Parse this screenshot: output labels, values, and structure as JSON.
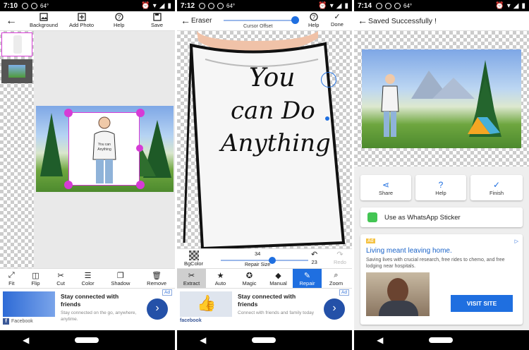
{
  "status": [
    {
      "time": "7:10",
      "temp": "64°"
    },
    {
      "time": "7:12",
      "temp": "64°"
    },
    {
      "time": "7:14",
      "temp": "64°"
    }
  ],
  "screen1": {
    "toolbar": {
      "background": "Background",
      "add_photo": "Add Photo",
      "help": "Help",
      "save": "Save"
    },
    "bottom_tools": [
      "Fit",
      "Flip",
      "Cut",
      "Color",
      "Shadow",
      "Remove"
    ],
    "ad": {
      "tag": "Ad",
      "title": "Stay connected with friends",
      "body": "Stay connected on the go, anywhere, anytime.",
      "advertiser": "Facebook"
    }
  },
  "screen2": {
    "title": "Eraser",
    "slider_label": "Cursor Offset",
    "help": "Help",
    "done": "Done",
    "bgcolor": "BgColor",
    "repair_size_value": "34",
    "repair_size_label": "Repair Size",
    "undo_count": "23",
    "redo": "Redo",
    "tools": [
      "Extract",
      "Auto",
      "Magic",
      "Manual",
      "Repair",
      "Zoom"
    ],
    "active_tool": "Repair",
    "shirt_text": [
      "You",
      "can Do",
      "Anything"
    ],
    "ad": {
      "tag": "Ad",
      "title": "Stay connected with friends",
      "body": "Connect with friends and family today",
      "advertiser": "facebook"
    }
  },
  "screen3": {
    "title": "Saved Successfully !",
    "actions": [
      "Share",
      "Help",
      "Finish"
    ],
    "whatsapp": "Use as WhatsApp Sticker",
    "ad": {
      "tag": "Ad",
      "title": "Living meant leaving home.",
      "body": "Saving lives with crucial research, free rides to chemo, and free lodging near hospitals.",
      "cta": "VISIT SITE"
    }
  },
  "colors": {
    "accent": "#1f6fe0",
    "selection": "#d63bd6",
    "ad_button": "#2451a8",
    "whatsapp": "#43c553"
  }
}
